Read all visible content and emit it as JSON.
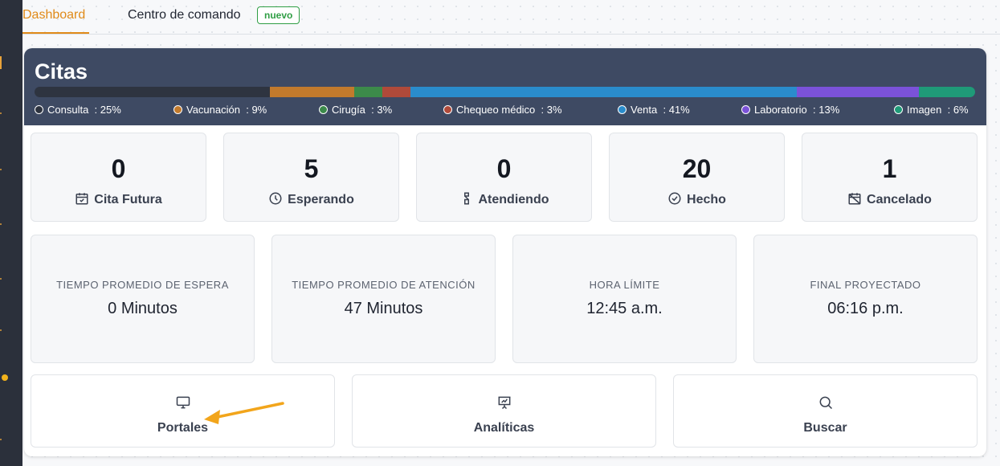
{
  "tabs": [
    {
      "label": "Dashboard",
      "active": true
    },
    {
      "label": "Centro de comando",
      "badge": "nuevo"
    }
  ],
  "citas": {
    "title": "Citas",
    "segments": [
      {
        "name": "Consulta",
        "percent": "25%",
        "value": 25,
        "color": "#2e3440"
      },
      {
        "name": "Vacunación",
        "percent": "9%",
        "value": 9,
        "color": "#c27a2c"
      },
      {
        "name": "Cirugía",
        "percent": "3%",
        "value": 3,
        "color": "#3c8a4a"
      },
      {
        "name": "Chequeo médico",
        "percent": "3%",
        "value": 3,
        "color": "#b04a3a"
      },
      {
        "name": "Venta",
        "percent": "41%",
        "value": 41,
        "color": "#2a8ccc"
      },
      {
        "name": "Laboratorio",
        "percent": "13%",
        "value": 13,
        "color": "#7b52d9"
      },
      {
        "name": "Imagen",
        "percent": "6%",
        "value": 6,
        "color": "#1f9a78"
      }
    ]
  },
  "stats": [
    {
      "value": "0",
      "label": "Cita Futura",
      "icon": "calendar-check-icon"
    },
    {
      "value": "5",
      "label": "Esperando",
      "icon": "clock-icon"
    },
    {
      "value": "0",
      "label": "Atendiendo",
      "icon": "hourglass-icon"
    },
    {
      "value": "20",
      "label": "Hecho",
      "icon": "check-circle-icon"
    },
    {
      "value": "1",
      "label": "Cancelado",
      "icon": "calendar-x-icon"
    }
  ],
  "metrics": [
    {
      "caption": "TIEMPO PROMEDIO DE ESPERA",
      "value": "0 Minutos"
    },
    {
      "caption": "TIEMPO PROMEDIO DE ATENCIÓN",
      "value": "47 Minutos"
    },
    {
      "caption": "HORA LÍMITE",
      "value": "12:45 a.m."
    },
    {
      "caption": "FINAL PROYECTADO",
      "value": "06:16 p.m."
    }
  ],
  "actions": [
    {
      "label": "Portales",
      "icon": "monitor-icon"
    },
    {
      "label": "Analíticas",
      "icon": "presentation-chart-icon"
    },
    {
      "label": "Buscar",
      "icon": "search-icon"
    }
  ],
  "colors": {
    "accent": "#e08a18",
    "header_bg": "#3e4a63",
    "badge_green": "#2f9e44",
    "arrow": "#f2a51b"
  }
}
